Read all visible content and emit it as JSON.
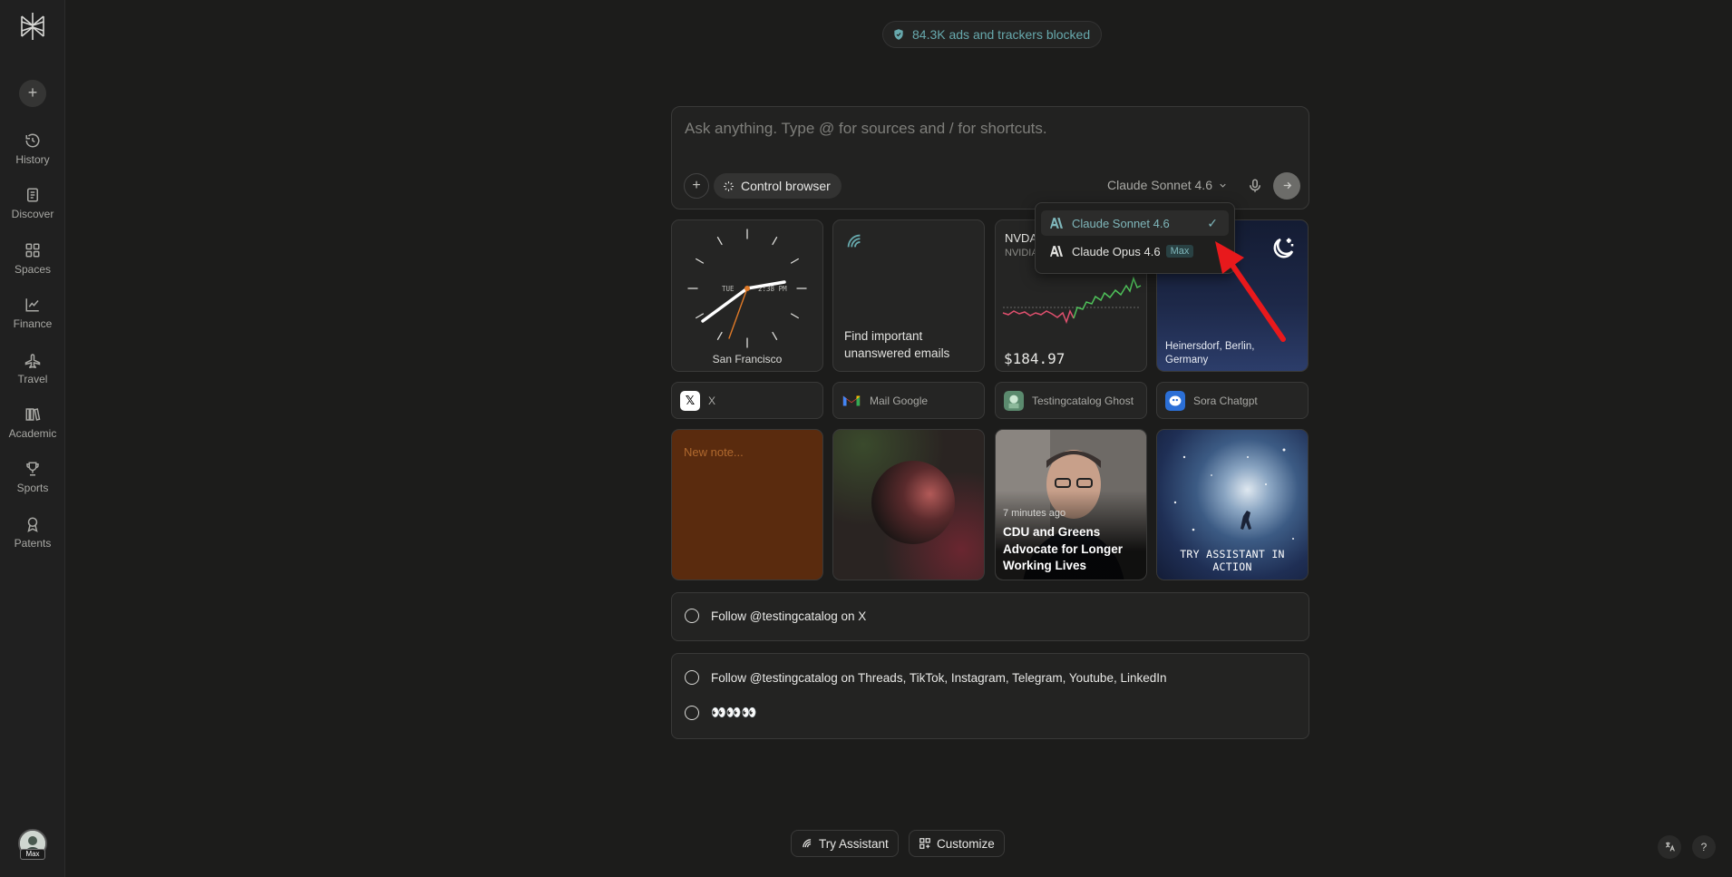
{
  "sidebar": {
    "new_label": "+",
    "items": [
      {
        "label": "History",
        "icon": "history-icon"
      },
      {
        "label": "Discover",
        "icon": "discover-icon"
      },
      {
        "label": "Spaces",
        "icon": "spaces-icon"
      },
      {
        "label": "Finance",
        "icon": "finance-icon"
      },
      {
        "label": "Travel",
        "icon": "travel-icon"
      },
      {
        "label": "Academic",
        "icon": "academic-icon"
      },
      {
        "label": "Sports",
        "icon": "sports-icon"
      },
      {
        "label": "Patents",
        "icon": "patents-icon"
      }
    ],
    "avatar_badge": "Max"
  },
  "blocked": {
    "text": "84.3K ads and trackers blocked"
  },
  "ask": {
    "placeholder": "Ask anything. Type @ for sources and / for shortcuts.",
    "control_browser": "Control browser",
    "model": "Claude Sonnet 4.6"
  },
  "dropdown": {
    "items": [
      {
        "label": "Claude Sonnet 4.6",
        "selected": true
      },
      {
        "label": "Claude Opus 4.6",
        "badge": "Max"
      }
    ]
  },
  "widgets": {
    "clock": {
      "city": "San Francisco",
      "day": "TUE",
      "time": "2:38 PM"
    },
    "email": {
      "text": "Find important unanswered emails"
    },
    "stock": {
      "ticker": "NVDA",
      "name": "NVIDIA",
      "price": "$184.97"
    },
    "weather": {
      "location": "Heinersdorf, Berlin, Germany"
    }
  },
  "shortcuts": [
    {
      "label": "X",
      "icon": "x-logo-icon"
    },
    {
      "label": "Mail Google",
      "icon": "gmail-icon"
    },
    {
      "label": "Testingcatalog Ghost",
      "icon": "ghost-icon"
    },
    {
      "label": "Sora Chatgpt",
      "icon": "sora-icon"
    }
  ],
  "cards": {
    "note": {
      "placeholder": "New note..."
    },
    "news": {
      "time": "7 minutes ago",
      "title": "CDU and Greens Advocate for Longer Working Lives"
    },
    "assistant": {
      "label": "TRY ASSISTANT IN ACTION"
    }
  },
  "tasks": {
    "group1": [
      "Follow @testingcatalog on X"
    ],
    "group2": [
      "Follow @testingcatalog on Threads, TikTok, Instagram, Telegram, Youtube, LinkedIn",
      "👀👀👀"
    ]
  },
  "bottom": {
    "try_assistant": "Try Assistant",
    "customize": "Customize"
  },
  "colors": {
    "accent": "#67a9ad",
    "background": "#1c1c1b",
    "note": "#5a2b0e",
    "arrow": "#e8191c",
    "stock_up": "#4fc25a",
    "stock_down": "#e0506e"
  }
}
